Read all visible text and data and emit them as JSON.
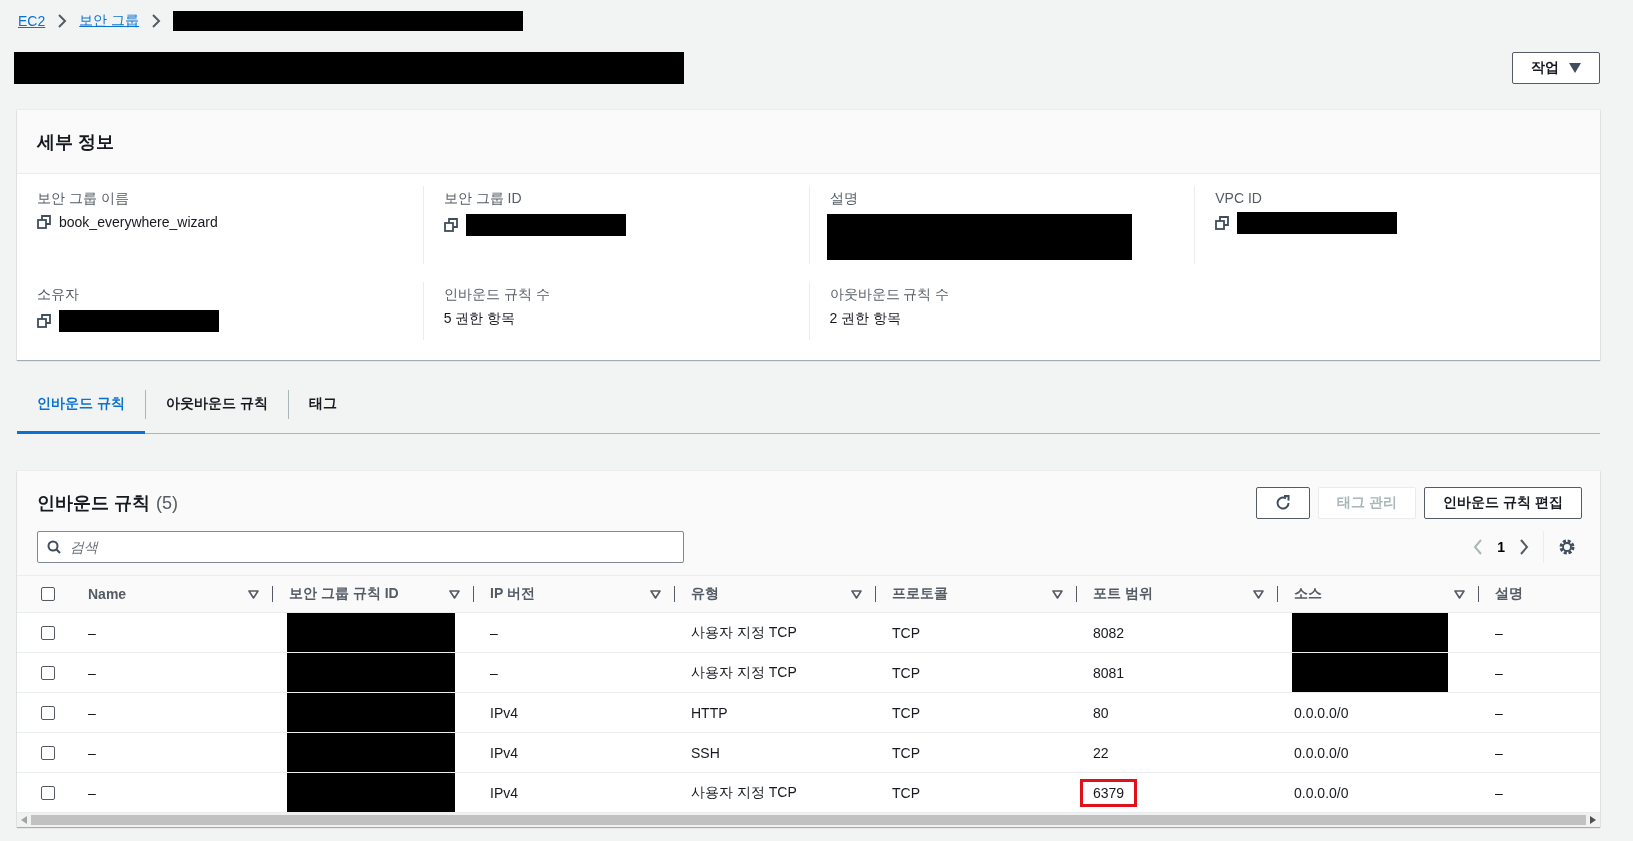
{
  "breadcrumb": [
    {
      "kind": "link",
      "label": "EC2"
    },
    {
      "kind": "link",
      "label": "보안 그룹"
    },
    {
      "kind": "redacted"
    }
  ],
  "title": {
    "redacted": true
  },
  "actions_button": {
    "label": "작업"
  },
  "details": {
    "title": "세부 정보",
    "fields": [
      {
        "label": "보안 그룹 이름",
        "value": "book_everywhere_wizard",
        "copyable": true,
        "redacted": false,
        "multiline": false
      },
      {
        "label": "보안 그룹 ID",
        "copyable": true,
        "redacted": true,
        "multiline": false
      },
      {
        "label": "설명",
        "copyable": false,
        "redacted": true,
        "multiline": true
      },
      {
        "label": "VPC ID",
        "copyable": true,
        "redacted": true,
        "multiline": false
      },
      {
        "label": "소유자",
        "copyable": true,
        "redacted": true,
        "multiline": false
      },
      {
        "label": "인바운드 규칙 수",
        "value": "5 권한 항목",
        "copyable": false,
        "redacted": false,
        "multiline": false
      },
      {
        "label": "아웃바운드 규칙 수",
        "value": "2 권한 항목",
        "copyable": false,
        "redacted": false,
        "multiline": false
      }
    ]
  },
  "tabs": [
    {
      "label": "인바운드 규칙",
      "selected": true
    },
    {
      "label": "아웃바운드 규칙",
      "selected": false
    },
    {
      "label": "태그",
      "selected": false
    }
  ],
  "rules_panel": {
    "title": "인바운드 규칙",
    "count": "(5)",
    "buttons": [
      {
        "kind": "refresh",
        "disabled": false
      },
      {
        "kind": "text",
        "label": "태그 관리",
        "disabled": true
      },
      {
        "kind": "text",
        "label": "인바운드 규칙 편집",
        "disabled": false
      }
    ],
    "search": {
      "placeholder": "검색"
    },
    "pagination": {
      "page": "1",
      "prev_disabled": true,
      "next_disabled": false
    },
    "table": {
      "select_all": false,
      "columns": [
        {
          "label": "Name",
          "sortable": true
        },
        {
          "label": "보안 그룹 규칙 ID",
          "sortable": true
        },
        {
          "label": "IP 버전",
          "sortable": true
        },
        {
          "label": "유형",
          "sortable": true
        },
        {
          "label": "프로토콜",
          "sortable": true
        },
        {
          "label": "포트 범위",
          "sortable": true
        },
        {
          "label": "소스",
          "sortable": true
        },
        {
          "label": "설명",
          "sortable": false
        }
      ],
      "rows": [
        {
          "selected": false,
          "cells": [
            {
              "text": "–"
            },
            {
              "redacted": true
            },
            {
              "text": "–"
            },
            {
              "text": "사용자 지정 TCP"
            },
            {
              "text": "TCP"
            },
            {
              "text": "8082"
            },
            {
              "redacted": true
            },
            {
              "text": "–"
            }
          ]
        },
        {
          "selected": false,
          "cells": [
            {
              "text": "–"
            },
            {
              "redacted": true
            },
            {
              "text": "–"
            },
            {
              "text": "사용자 지정 TCP"
            },
            {
              "text": "TCP"
            },
            {
              "text": "8081"
            },
            {
              "redacted": true
            },
            {
              "text": "–"
            }
          ]
        },
        {
          "selected": false,
          "cells": [
            {
              "text": "–"
            },
            {
              "redacted": true
            },
            {
              "text": "IPv4"
            },
            {
              "text": "HTTP"
            },
            {
              "text": "TCP"
            },
            {
              "text": "80"
            },
            {
              "text": "0.0.0.0/0"
            },
            {
              "text": "–"
            }
          ]
        },
        {
          "selected": false,
          "cells": [
            {
              "text": "–"
            },
            {
              "redacted": true
            },
            {
              "text": "IPv4"
            },
            {
              "text": "SSH"
            },
            {
              "text": "TCP"
            },
            {
              "text": "22"
            },
            {
              "text": "0.0.0.0/0"
            },
            {
              "text": "–"
            }
          ]
        },
        {
          "selected": false,
          "cells": [
            {
              "text": "–"
            },
            {
              "redacted": true
            },
            {
              "text": "IPv4"
            },
            {
              "text": "사용자 지정 TCP"
            },
            {
              "text": "TCP"
            },
            {
              "text": "6379",
              "highlighted": true
            },
            {
              "text": "0.0.0.0/0"
            },
            {
              "text": "–"
            }
          ]
        }
      ]
    }
  }
}
